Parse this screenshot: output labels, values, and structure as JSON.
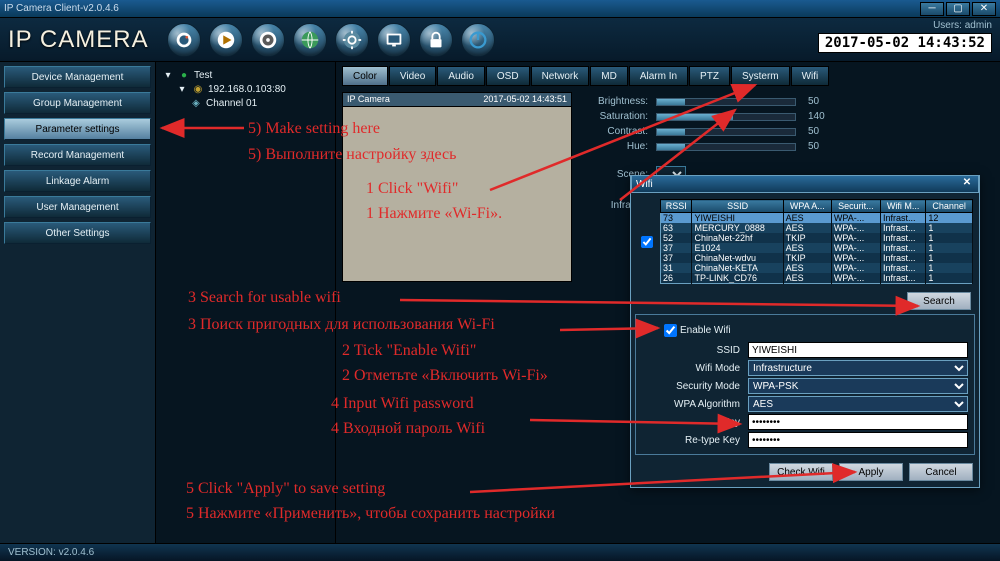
{
  "window_title": "IP Camera Client-v2.0.4.6",
  "logo": "IP CAMERA",
  "header": {
    "user_label": "Users:",
    "user_name": "admin",
    "timestamp": "2017-05-02 14:43:52"
  },
  "toolbar_icons": [
    "camera",
    "play",
    "record",
    "globe",
    "gear",
    "monitor",
    "lock",
    "power"
  ],
  "sidebar": {
    "items": [
      "Device Management",
      "Group Management",
      "Parameter settings",
      "Record Management",
      "Linkage Alarm",
      "User Management",
      "Other Settings"
    ],
    "active_index": 2
  },
  "tree": {
    "root": "Test",
    "ip": "192.168.0.103:80",
    "channel": "Channel 01"
  },
  "tabs": [
    "Color",
    "Video",
    "Audio",
    "OSD",
    "Network",
    "MD",
    "Alarm In",
    "PTZ",
    "Systerm",
    "Wifi"
  ],
  "tabs_active_index": 0,
  "preview": {
    "title": "IP Camera",
    "overlay_ts": "2017-05-02 14:43:51"
  },
  "sliders": [
    {
      "label": "Brightness:",
      "value": 50,
      "max": 255
    },
    {
      "label": "Saturation:",
      "value": 140,
      "max": 255
    },
    {
      "label": "Contrast:",
      "value": 50,
      "max": 255
    },
    {
      "label": "Hue:",
      "value": 50,
      "max": 255
    }
  ],
  "scene_label": "Scene:",
  "infrared_label": "Infrared:",
  "wifi_dialog": {
    "title": "Wifi",
    "columns": [
      "RSSI",
      "SSID",
      "WPA A...",
      "Securit...",
      "Wifi M...",
      "Channel"
    ],
    "rows": [
      {
        "rssi": "73",
        "ssid": "YIWEISHI",
        "wpa": "AES",
        "sec": "WPA-...",
        "mode": "Infrast...",
        "ch": "12",
        "sel": true
      },
      {
        "rssi": "63",
        "ssid": "MERCURY_0888",
        "wpa": "AES",
        "sec": "WPA-...",
        "mode": "Infrast...",
        "ch": "1"
      },
      {
        "rssi": "52",
        "ssid": "ChinaNet-22hf",
        "wpa": "TKIP",
        "sec": "WPA-...",
        "mode": "Infrast...",
        "ch": "1"
      },
      {
        "rssi": "37",
        "ssid": "E1024",
        "wpa": "AES",
        "sec": "WPA-...",
        "mode": "Infrast...",
        "ch": "1"
      },
      {
        "rssi": "37",
        "ssid": "ChinaNet-wdvu",
        "wpa": "TKIP",
        "sec": "WPA-...",
        "mode": "Infrast...",
        "ch": "1"
      },
      {
        "rssi": "31",
        "ssid": "ChinaNet-KETA",
        "wpa": "AES",
        "sec": "WPA-...",
        "mode": "Infrast...",
        "ch": "1"
      },
      {
        "rssi": "26",
        "ssid": "TP-LINK_CD76",
        "wpa": "AES",
        "sec": "WPA-...",
        "mode": "Infrast...",
        "ch": "1"
      }
    ],
    "search_btn": "Search",
    "enable_label": "Enable Wifi",
    "form": {
      "ssid_label": "SSID",
      "ssid_value": "YIWEISHI",
      "wifi_mode_label": "Wifi Mode",
      "wifi_mode_value": "Infrastructure",
      "sec_mode_label": "Security Mode",
      "sec_mode_value": "WPA-PSK",
      "wpa_alg_label": "WPA Algorithm",
      "wpa_alg_value": "AES",
      "key_label": "Key",
      "key_value": "••••••••",
      "rekey_label": "Re-type Key",
      "rekey_value": "••••••••"
    },
    "buttons": {
      "check": "Check Wifi",
      "apply": "Apply",
      "cancel": "Cancel"
    }
  },
  "statusbar": {
    "version_label": "VERSION:",
    "version": "v2.0.4.6"
  },
  "annotations": {
    "step5a": "5) Make setting here",
    "step5a_ru": "5) Выполните настройку здесь",
    "step1": "1 Click \"Wifi\"",
    "step1_ru": "1 Нажмите «Wi-Fi».",
    "step3": "3 Search for usable wifi",
    "step3_ru": "3 Поиск пригодных для использования Wi-Fi",
    "step2": "2 Tick \"Enable Wifi\"",
    "step2_ru": "2 Отметьте «Включить Wi-Fi»",
    "step4": "4 Input Wifi password",
    "step4_ru": "4 Входной пароль Wifi",
    "step_apply": "5 Click \"Apply\" to save setting",
    "step_apply_ru": "5 Нажмите «Применить», чтобы сохранить настройки"
  }
}
